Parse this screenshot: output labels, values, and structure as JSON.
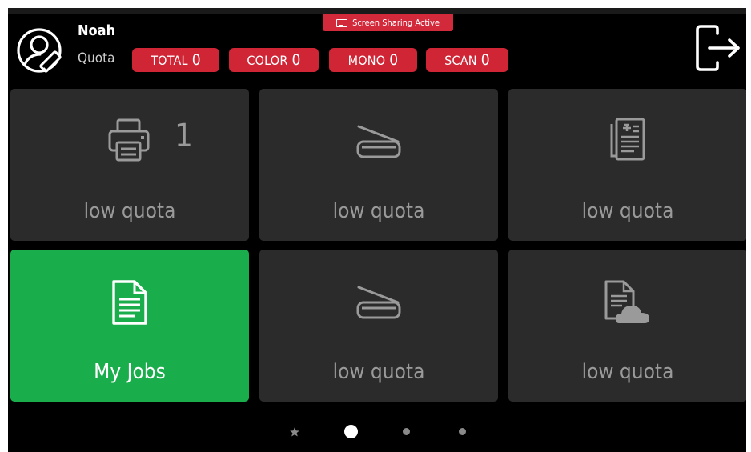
{
  "banner": {
    "text": "Screen Sharing Active",
    "icon": "screen-share-icon"
  },
  "user": {
    "name": "Noah",
    "avatar_icon": "user-edit-icon"
  },
  "quota": {
    "label": "Quota",
    "pills": [
      {
        "label": "TOTAL",
        "value": "0"
      },
      {
        "label": "COLOR",
        "value": "0"
      },
      {
        "label": "MONO",
        "value": "0"
      },
      {
        "label": "SCAN",
        "value": "0"
      }
    ]
  },
  "logout_icon": "logout-icon",
  "tiles": [
    {
      "icon": "printer-icon",
      "count": "1",
      "caption": "low quota"
    },
    {
      "icon": "scanner-icon",
      "caption": "low quota"
    },
    {
      "icon": "copy-document-icon",
      "caption": "low quota"
    },
    {
      "icon": "document-icon",
      "caption": "My Jobs"
    },
    {
      "icon": "scanner-icon",
      "caption": "low quota"
    },
    {
      "icon": "cloud-document-icon",
      "caption": "low quota"
    }
  ],
  "pager": {
    "pages": 4,
    "current": 2,
    "first_is_favorites": true
  },
  "colors": {
    "accent_red": "#cf2535",
    "tile_bg": "#2b2b2b",
    "active_green": "#1aad4b"
  }
}
